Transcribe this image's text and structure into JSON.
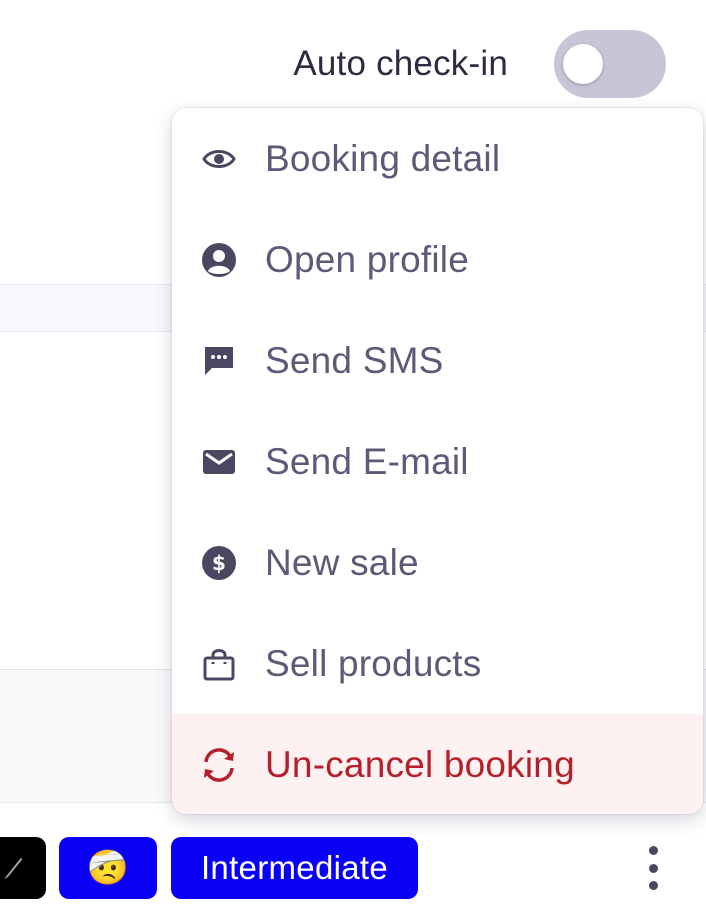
{
  "header": {
    "auto_checkin_label": "Auto check-in",
    "auto_checkin_enabled": false
  },
  "menu": {
    "items": [
      {
        "label": "Booking detail",
        "icon": "eye-icon"
      },
      {
        "label": "Open profile",
        "icon": "user-circle-icon"
      },
      {
        "label": "Send SMS",
        "icon": "message-bubble-icon"
      },
      {
        "label": "Send E-mail",
        "icon": "envelope-icon"
      },
      {
        "label": "New sale",
        "icon": "dollar-circle-icon"
      },
      {
        "label": "Sell products",
        "icon": "shopping-bag-icon"
      },
      {
        "label": "Un-cancel booking",
        "icon": "refresh-icon"
      }
    ]
  },
  "footer": {
    "level_badge": "Intermediate",
    "emoji_badge": "🤕",
    "more_icon": "kebab-menu-icon"
  },
  "colors": {
    "text_primary": "#2e2a3f",
    "menu_text": "#5f5977",
    "danger": "#b51f2c",
    "danger_bg": "#fdf1f1",
    "badge_blue": "#0a00f5",
    "toggle_off": "#c9c5d6"
  }
}
